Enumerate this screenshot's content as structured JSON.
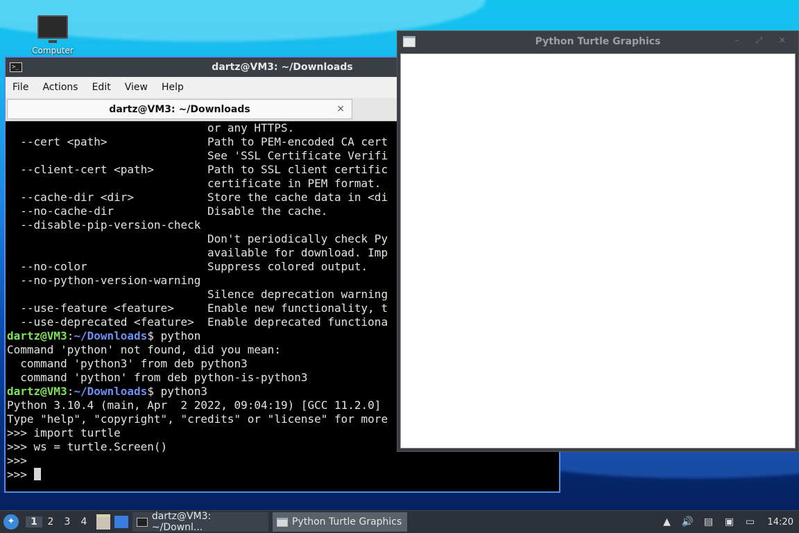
{
  "desktop": {
    "icon_label": "Computer"
  },
  "terminal": {
    "title": "dartz@VM3: ~/Downloads",
    "menu": [
      "File",
      "Actions",
      "Edit",
      "View",
      "Help"
    ],
    "tab_label": "dartz@VM3: ~/Downloads",
    "tab_close": "×",
    "prompt_user": "dartz@VM3",
    "prompt_sep": ":",
    "prompt_path": "~/Downloads",
    "prompt_end": "$ ",
    "output_top": [
      "                              or any HTTPS.",
      "  --cert <path>               Path to PEM-encoded CA cert",
      "                              See 'SSL Certificate Verifi",
      "  --client-cert <path>        Path to SSL client certific",
      "                              certificate in PEM format.",
      "  --cache-dir <dir>           Store the cache data in <di",
      "  --no-cache-dir              Disable the cache.",
      "  --disable-pip-version-check",
      "                              Don't periodically check Py",
      "                              available for download. Imp",
      "  --no-color                  Suppress colored output.",
      "  --no-python-version-warning",
      "                              Silence deprecation warning",
      "  --use-feature <feature>     Enable new functionality, t",
      "  --use-deprecated <feature>  Enable deprecated functiona"
    ],
    "cmd1": "python",
    "output_mid": [
      "Command 'python' not found, did you mean:",
      "  command 'python3' from deb python3",
      "  command 'python' from deb python-is-python3"
    ],
    "cmd2": "python3",
    "output_python": [
      "Python 3.10.4 (main, Apr  2 2022, 09:04:19) [GCC 11.2.0]",
      "Type \"help\", \"copyright\", \"credits\" or \"license\" for more",
      ">>> import turtle",
      ">>> ws = turtle.Screen()",
      ">>>"
    ],
    "current_prompt": ">>> "
  },
  "turtle_window": {
    "title": "Python Turtle Graphics",
    "buttons": "– ⤢ ✕"
  },
  "taskbar": {
    "start_icon": "start-menu-icon",
    "workspaces": [
      "1",
      "2",
      "3",
      "4"
    ],
    "tasks": [
      "dartz@VM3: ~/Downl...",
      "Python Turtle Graphics"
    ],
    "clock": "14:20"
  }
}
